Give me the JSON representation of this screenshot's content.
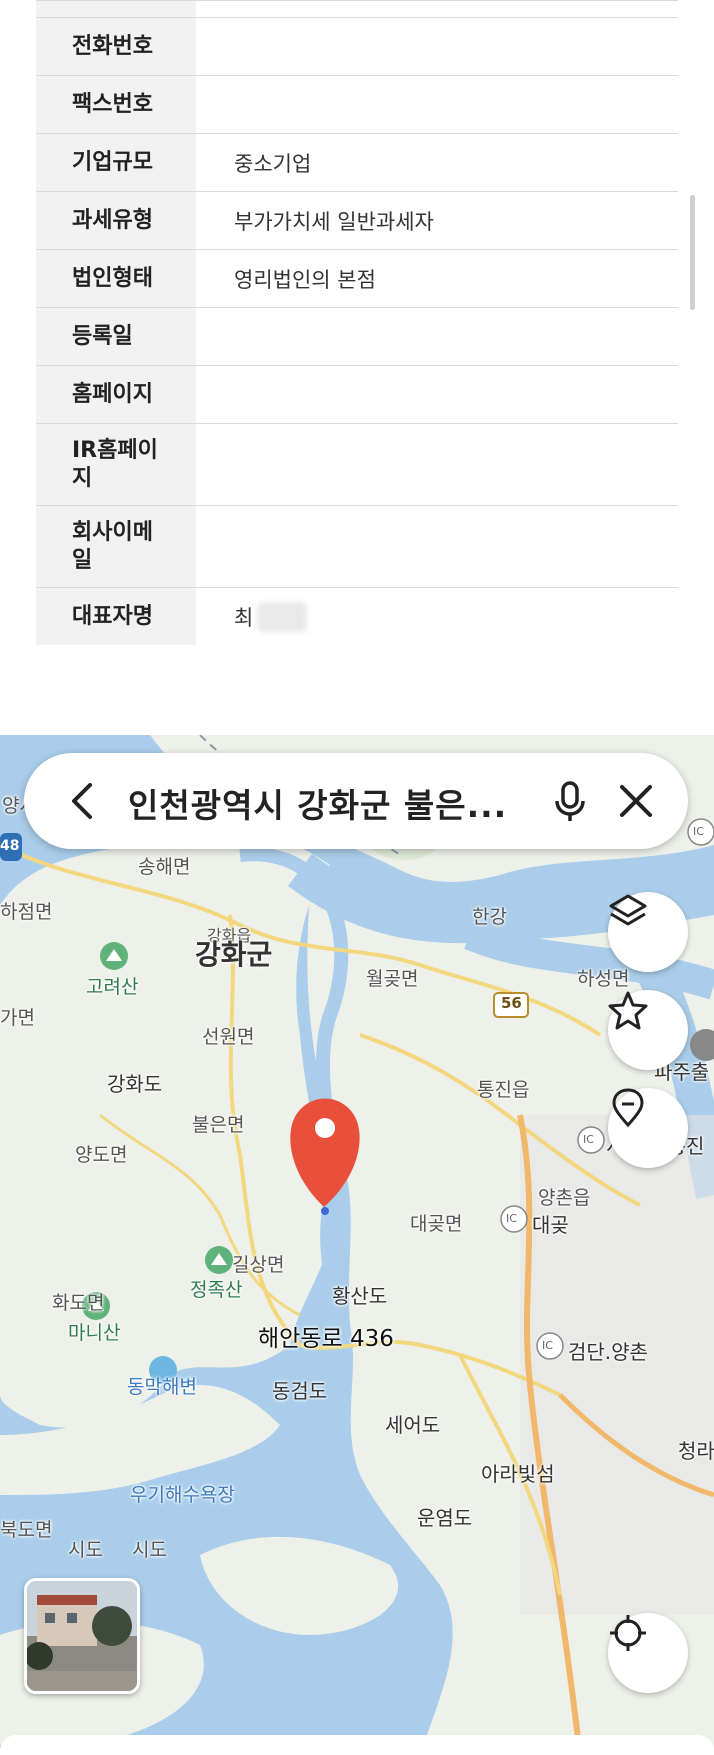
{
  "info_table": {
    "rows": [
      {
        "label": "전화번호",
        "value": ""
      },
      {
        "label": "팩스번호",
        "value": ""
      },
      {
        "label": "기업규모",
        "value": "중소기업"
      },
      {
        "label": "과세유형",
        "value": "부가가치세 일반과세자"
      },
      {
        "label": "법인형태",
        "value": "영리법인의 본점"
      },
      {
        "label": "등록일",
        "value": ""
      },
      {
        "label": "홈페이지",
        "value": ""
      },
      {
        "label": "IR홈페이\n지",
        "value": ""
      },
      {
        "label": "회사이메\n일",
        "value": ""
      },
      {
        "label": "대표자명",
        "value": "최"
      }
    ]
  },
  "map": {
    "search_text": "인천광역시 강화군 불은...",
    "pin_label": "해안동로 436",
    "route_badge": "56",
    "left_badge": "48",
    "labels": {
      "yangsa": "양사면",
      "songhae": "송해면",
      "hajeom": "하점면",
      "ganghwa_small": "강화읍",
      "ganghwa_gun": "강화군",
      "goryeosan": "고려산",
      "gamyeon": "가면",
      "seonwon": "선원면",
      "ganghwado": "강화도",
      "buleun": "불은면",
      "yangdo": "양도면",
      "wolgot": "월곶면",
      "hangang": "한강",
      "haseong": "하성면",
      "tongjin": "통진읍",
      "paju": "파주출",
      "seogimpo": "서김포.통진",
      "yangchon": "양촌읍",
      "daegot_myeon": "대곶면",
      "daegot_ic": "대곶",
      "jeongjoksan": "정족산",
      "gilsang": "길상면",
      "hwangsando": "황산도",
      "hwado": "화도면",
      "manisan": "마니산",
      "geomdan": "검단.양촌",
      "dongmak": "동막해변",
      "donggeomdo": "동검도",
      "seeodo": "세어도",
      "arabit": "아라빛섬",
      "cheongra": "청라",
      "ungyeomdo": "운염도",
      "bukdo": "북도면",
      "sido1": "시도",
      "sido2": "시도",
      "haesuyok": "우기해수욕장"
    },
    "ic_badge": "IC"
  }
}
